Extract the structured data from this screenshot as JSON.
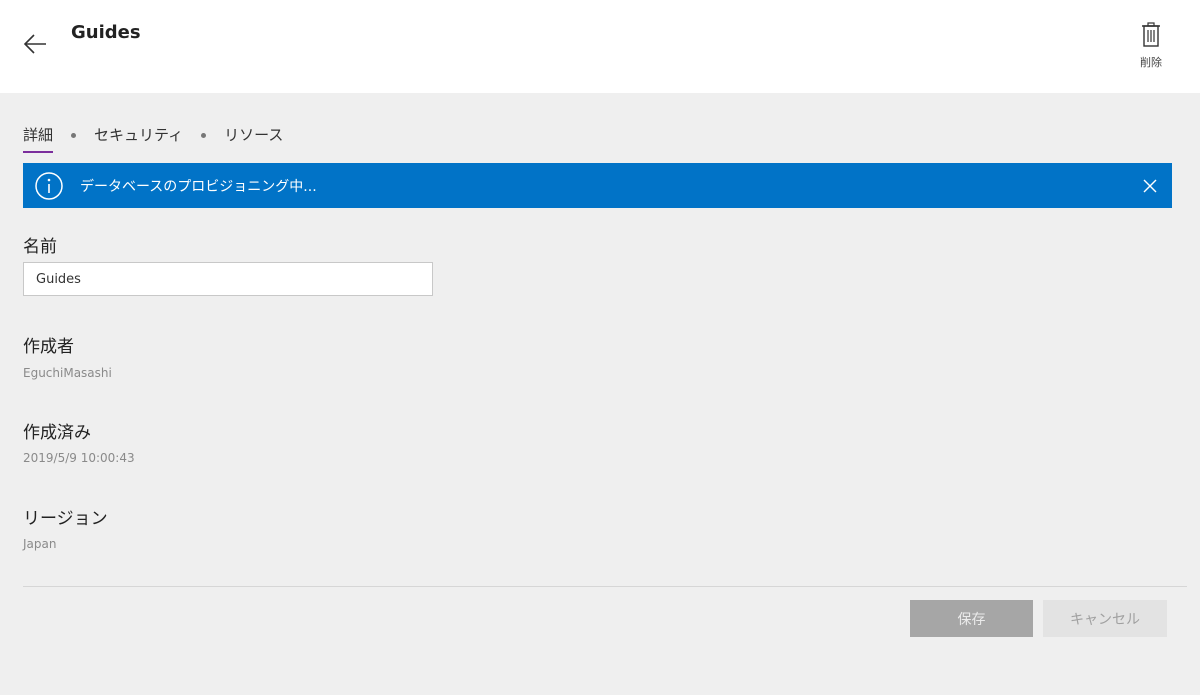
{
  "header": {
    "title": "Guides",
    "back_icon": "arrow-left-icon",
    "delete_icon": "trash-icon",
    "delete_label": "削除"
  },
  "tabs": [
    {
      "label": "詳細",
      "active": true
    },
    {
      "label": "セキュリティ",
      "active": false
    },
    {
      "label": "リソース",
      "active": false
    }
  ],
  "banner": {
    "icon": "info-icon",
    "text": "データベースのプロビジョニング中...",
    "close_icon": "close-icon",
    "color": "#0173c7"
  },
  "fields": {
    "name_label": "名前",
    "name_value": "Guides",
    "creator_label": "作成者",
    "creator_value": "EguchiMasashi",
    "created_label": "作成済み",
    "created_value": "2019/5/9 10:00:43",
    "region_label": "リージョン",
    "region_value": "Japan"
  },
  "actions": {
    "save_label": "保存",
    "cancel_label": "キャンセル"
  },
  "colors": {
    "accent": "#7b2e9c",
    "background": "#efefef"
  }
}
